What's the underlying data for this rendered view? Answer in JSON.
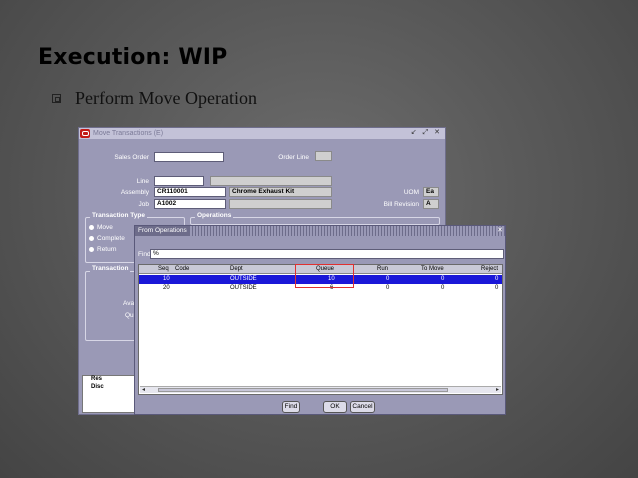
{
  "slide": {
    "title": "Execution: WIP",
    "bullet": "Perform Move Operation"
  },
  "back_form": {
    "title": "Move Transactions (E)",
    "window_controls": "↙ ⤢ ✕",
    "labels": {
      "sales_order": "Sales Order",
      "order_line": "Order Line",
      "line": "Line",
      "assembly": "Assembly",
      "job": "Job",
      "uom": "UOM",
      "bill_revision": "Bill Revision",
      "transaction_type": "Transaction Type",
      "operations": "Operations",
      "transaction": "Transaction",
      "avail": "Ava",
      "qty": "Qu"
    },
    "values": {
      "assembly": "CR110001",
      "assembly_desc": "Chrome Exhaust Kit",
      "job": "A1002",
      "uom": "Ea",
      "bill_revision": "A"
    },
    "radio": [
      "Move",
      "Complete",
      "Return"
    ],
    "lower_items": [
      "Res",
      "Disc"
    ]
  },
  "dialog": {
    "title": "From Operations",
    "close": "✕",
    "find_label": "Find",
    "find_value": "%",
    "columns": [
      "Seq",
      "Code",
      "Dept",
      "Queue",
      "Run",
      "To Move",
      "Reject"
    ],
    "rows": [
      {
        "seq": "10",
        "code": "",
        "dept": "OUTSIDE",
        "queue": "10",
        "run": "0",
        "to_move": "0",
        "reject": "0",
        "selected": true
      },
      {
        "seq": "20",
        "code": "",
        "dept": "OUTSIDE",
        "queue": "6",
        "run": "0",
        "to_move": "0",
        "reject": "0",
        "selected": false
      }
    ],
    "buttons": {
      "find": "Find",
      "ok": "OK",
      "cancel": "Cancel"
    }
  },
  "colors": {
    "accent_selected_row": "#1a17d8",
    "highlight_box": "#e03030",
    "form_bg": "#9a99b6"
  }
}
